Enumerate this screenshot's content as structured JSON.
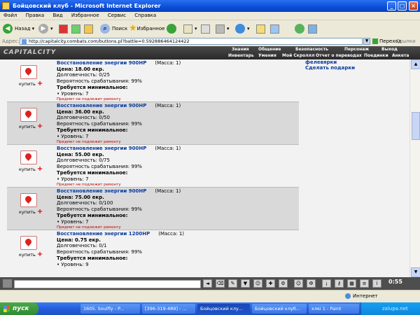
{
  "window": {
    "title": "Бойцовский клуб - Microsoft Internet Explorer"
  },
  "menu": [
    "Файл",
    "Правка",
    "Вид",
    "Избранное",
    "Сервис",
    "Справка"
  ],
  "toolbar": {
    "back": "Назад",
    "search": "Поиск",
    "favorites": "Избранное"
  },
  "address": {
    "label": "Адрес:",
    "url": "http://capitalcity.combats.com/buttons.pl?battle=0.592886464124422",
    "go": "Переход",
    "links": "Ссылки"
  },
  "site": {
    "logo": "CAPITALCITY",
    "nav_top": [
      "Знания",
      "Общение",
      "Безопасность",
      "Персонаж",
      "Выход"
    ],
    "nav_bottom": [
      "Инвентарь",
      "Умения",
      "Мой Скроллл",
      "Отчет о переводах",
      "Поединки",
      "Анкета"
    ]
  },
  "side": {
    "line1": "фелевярки",
    "line2": "Сделать подарки"
  },
  "buy_label": "купить",
  "items": [
    {
      "name": "Восстановление энергии 900HP",
      "mass": "(Масса: 1)",
      "price": "Цена: 18.00 екр.",
      "durability": "Долговечность: 0/25",
      "chance": "Вероятность срабатывания: 99%",
      "req": "Требуется минимальное:",
      "level": "• Уровень: 7",
      "note": "Предмет не подлежит ремонту"
    },
    {
      "name": "Восстановление энергии 900HP",
      "mass": "(Масса: 1)",
      "price": "Цена: 36.00 екр.",
      "durability": "Долговечность: 0/50",
      "chance": "Вероятность срабатывания: 99%",
      "req": "Требуется минимальное:",
      "level": "• Уровень: 7",
      "note": "Предмет не подлежит ремонту"
    },
    {
      "name": "Восстановление энергии 900HP",
      "mass": "(Масса: 1)",
      "price": "Цена: 55.00 екр.",
      "durability": "Долговечность: 0/75",
      "chance": "Вероятность срабатывания: 99%",
      "req": "Требуется минимальное:",
      "level": "• Уровень: 7",
      "note": "Предмет не подлежит ремонту"
    },
    {
      "name": "Восстановление энергии 900HP",
      "mass": "(Масса: 1)",
      "price": "Цена: 75.00 екр.",
      "durability": "Долговечность: 0/100",
      "chance": "Вероятность срабатывания: 99%",
      "req": "Требуется минимальное:",
      "level": "• Уровень: 7",
      "note": "Предмет не подлежит ремонту"
    },
    {
      "name": "Восстановление энергии 1200HP",
      "mass": "(Масса: 1)",
      "price": "Цена: 0.75 екр.",
      "durability": "Долговечность: 0/1",
      "chance": "Вероятность срабатывания: 99%",
      "req": "Требуется минимальное:",
      "level": "• Уровень: 9",
      "note": ""
    }
  ],
  "chat": {
    "clock": "0:55"
  },
  "status": {
    "zone": "Интернет"
  },
  "taskbar": {
    "start": "пуск",
    "tasks": [
      "1605. Soulfly - P...",
      "[396-319-489] - ...",
      "Бойцовский клу...",
      "Бойцовский клуб...",
      "хлкі 1 - Paint"
    ],
    "watermark": "zalupa.net"
  },
  "colors": {
    "link": "#0a3c9e",
    "alt_row": "#d9d9d9",
    "header_bg": "#2a2a2a",
    "xp_blue": "#245edc"
  }
}
